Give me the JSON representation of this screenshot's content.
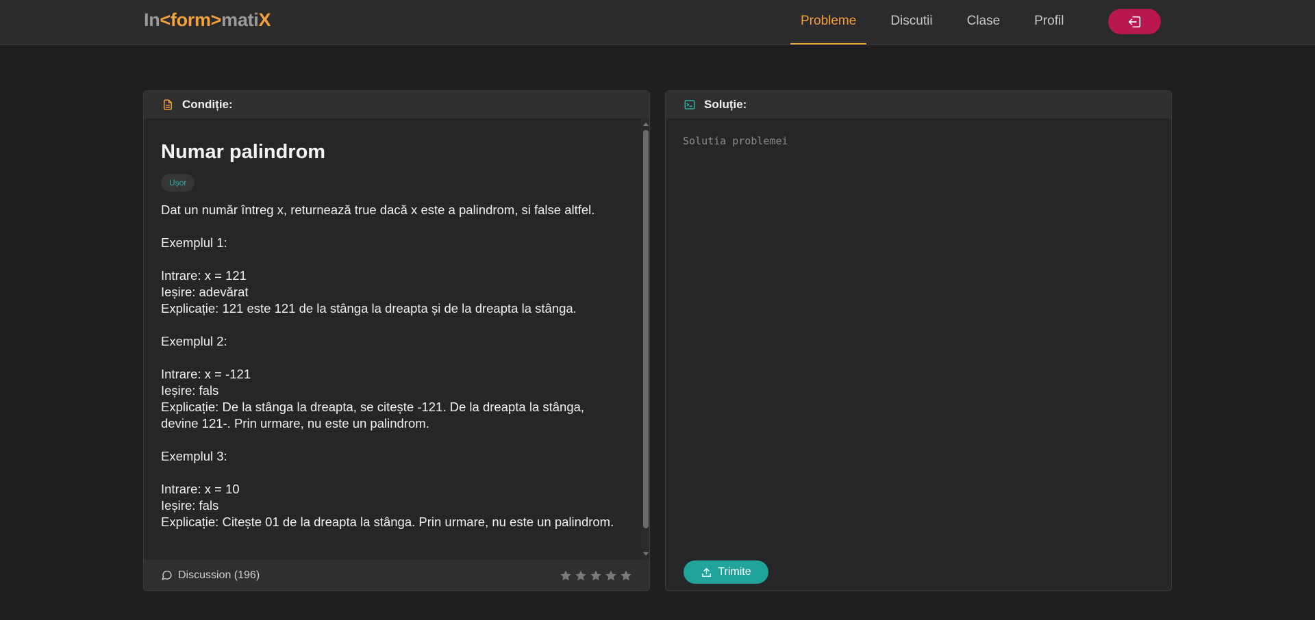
{
  "brand": {
    "logo_part1": "In",
    "logo_part2": "<form>",
    "logo_part3": "mati",
    "logo_part4": "X",
    "accent_color": "#f5a13a"
  },
  "nav": {
    "items": [
      {
        "label": "Probleme",
        "active": true
      },
      {
        "label": "Discutii",
        "active": false
      },
      {
        "label": "Clase",
        "active": false
      },
      {
        "label": "Profil",
        "active": false
      }
    ],
    "logout_icon": "logout-icon",
    "logout_color": "#b8184f"
  },
  "condition_panel": {
    "header": "Condiție:",
    "icon": "document-icon",
    "title": "Numar palindrom",
    "difficulty": "Ușor",
    "statement": "Dat un număr întreg x, returnează true dacă x este a palindrom, si false altfel.\n\nExemplul 1:\n\nIntrare: x = 121\nIeșire: adevărat\nExplicație: 121 este 121 de la stânga la dreapta și de la dreapta la stânga.\n\nExemplul 2:\n\nIntrare: x = -121\nIeșire: fals\nExplicație: De la stânga la dreapta, se citește -121. De la dreapta la stânga, devine 121-. Prin urmare, nu este un palindrom.\n\nExemplul 3:\n\nIntrare: x = 10\nIeșire: fals\nExplicație: Citește 01 de la dreapta la stânga. Prin urmare, nu este un palindrom.",
    "discussion_label": "Discussion (196)",
    "rating_stars": 5,
    "rating_filled": 0
  },
  "solution_panel": {
    "header": "Soluție:",
    "icon": "terminal-icon",
    "editor_placeholder": "Solutia problemei",
    "submit_label": "Trimite",
    "submit_color": "#1fa39a"
  }
}
